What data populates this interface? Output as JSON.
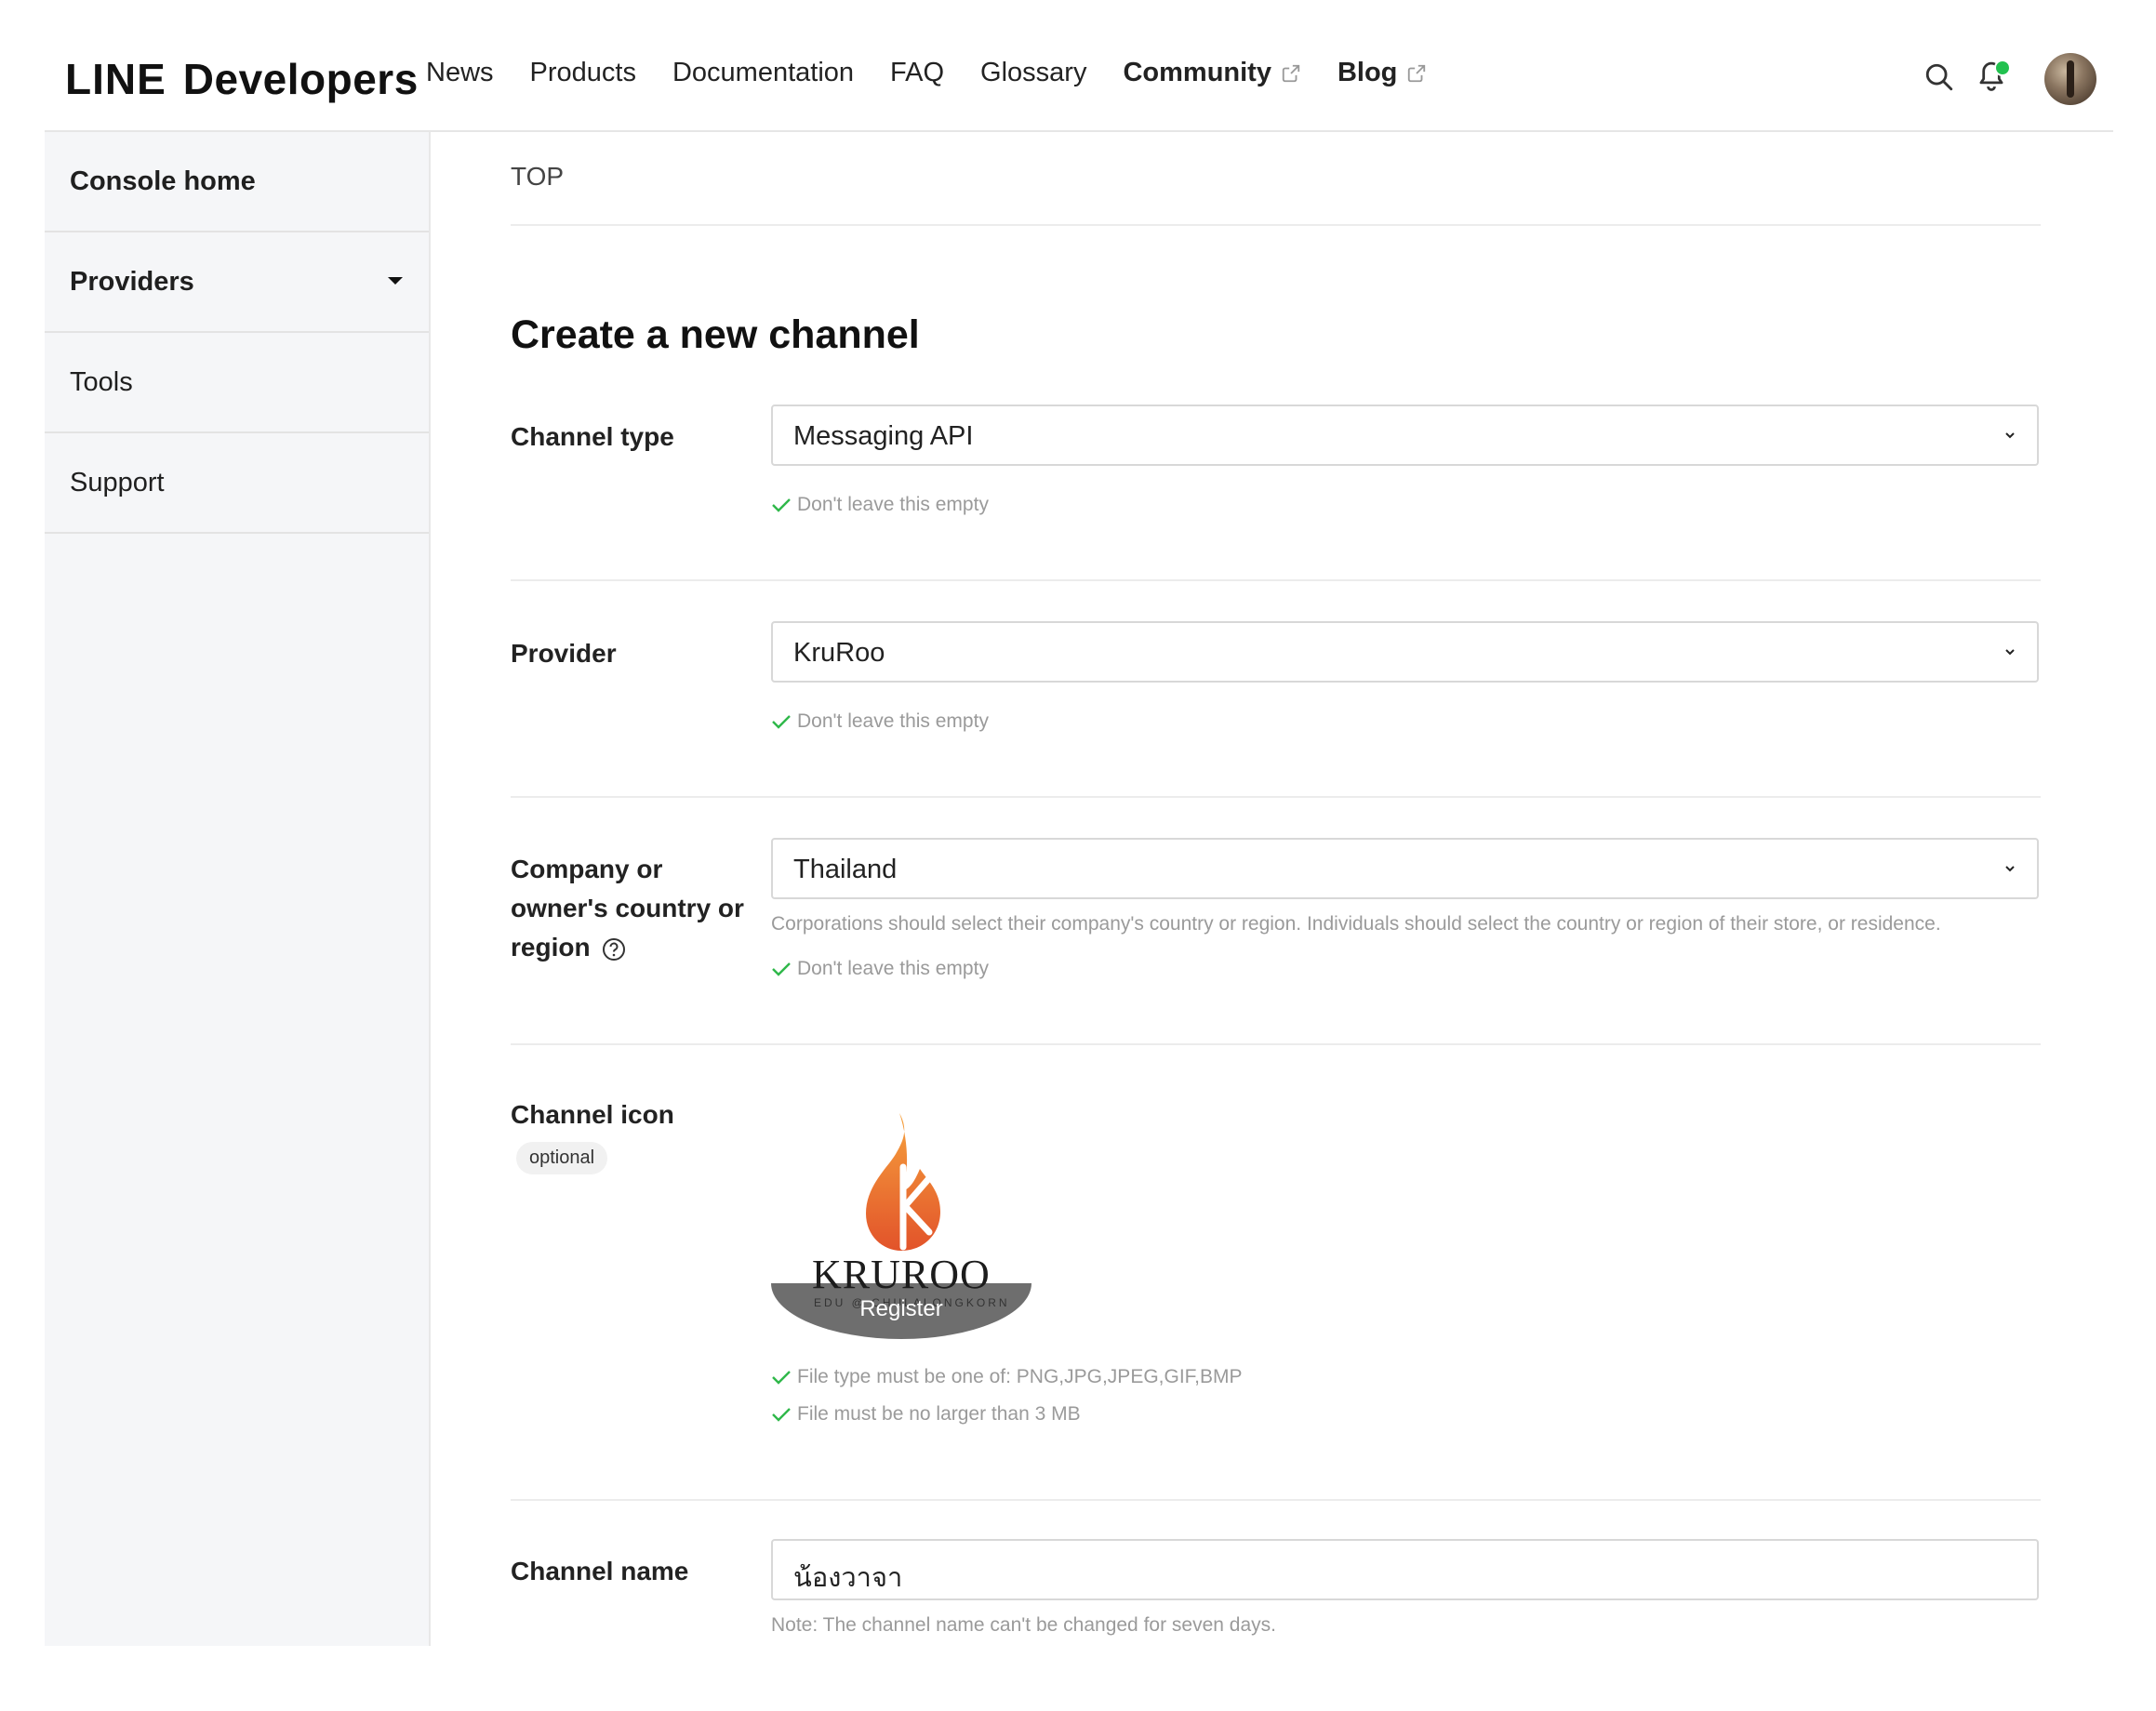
{
  "header": {
    "logo_line": "LINE",
    "logo_developers": "Developers",
    "nav": [
      {
        "label": "News",
        "external": false
      },
      {
        "label": "Products",
        "external": false
      },
      {
        "label": "Documentation",
        "external": false
      },
      {
        "label": "FAQ",
        "external": false
      },
      {
        "label": "Glossary",
        "external": false
      },
      {
        "label": "Community",
        "external": true
      },
      {
        "label": "Blog",
        "external": true
      }
    ],
    "notification_dot_color": "#22c14f"
  },
  "sidebar": {
    "items": [
      {
        "label": "Console home"
      },
      {
        "label": "Providers"
      },
      {
        "label": "Tools"
      },
      {
        "label": "Support"
      }
    ]
  },
  "main": {
    "breadcrumb": "TOP",
    "title": "Create a new channel",
    "channel_type": {
      "label": "Channel type",
      "value": "Messaging API",
      "validation": "Don't leave this empty"
    },
    "provider": {
      "label": "Provider",
      "value": "KruRoo",
      "validation": "Don't leave this empty"
    },
    "country": {
      "label_line1": "Company or",
      "label_line2": "owner's country or",
      "label_line3": "region",
      "value": "Thailand",
      "description": "Corporations should select their company's country or region. Individuals should select the country or region of their store, or residence.",
      "validation": "Don't leave this empty"
    },
    "channel_icon": {
      "label": "Channel icon",
      "badge": "optional",
      "brand": "KRUROO",
      "brand_sub": "EDU @ CHULALONGKORN",
      "register_label": "Register",
      "rule_file_type": "File type must be one of: PNG,JPG,JPEG,GIF,BMP",
      "rule_file_size": "File must be no larger than 3 MB"
    },
    "channel_name": {
      "label": "Channel name",
      "value": "น้องวาจา",
      "note": "Note: The channel name can't be changed for seven days."
    }
  },
  "colors": {
    "check": "#2fb84a",
    "logo_orange": "#ec6b2d"
  }
}
